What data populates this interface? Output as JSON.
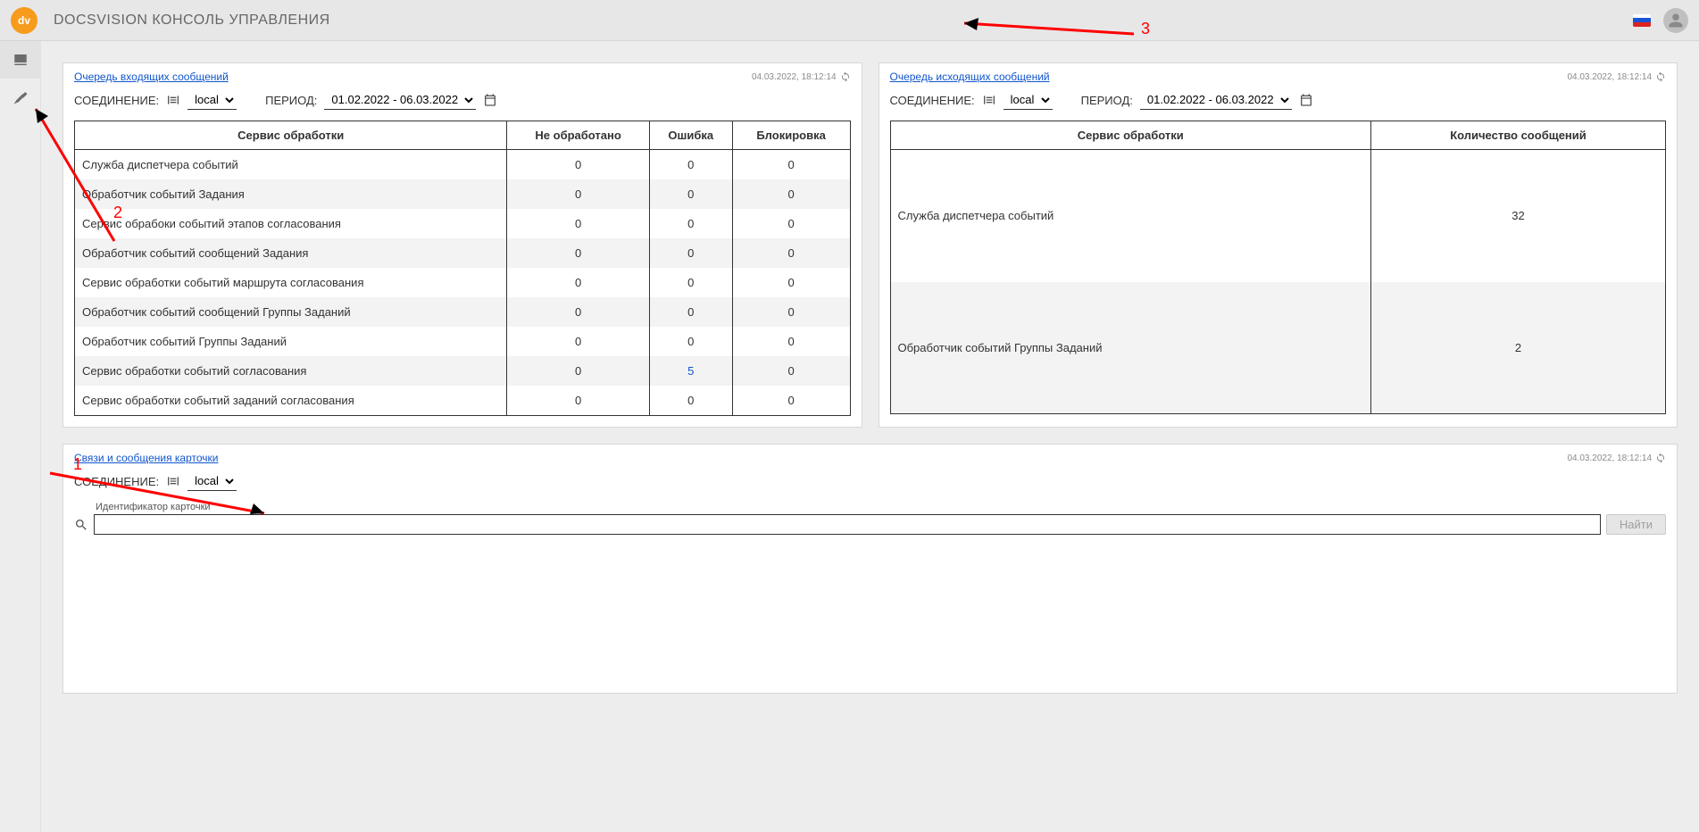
{
  "header": {
    "logo_text": "dv",
    "title": "DOCSVISION КОНСОЛЬ УПРАВЛЕНИЯ"
  },
  "annotations": {
    "n1": "1",
    "n2": "2",
    "n3": "3"
  },
  "incoming": {
    "link": "Очередь входящих сообщений",
    "timestamp": "04.03.2022, 18:12:14",
    "connection_label": "СОЕДИНЕНИЕ:",
    "connection_value": "local",
    "period_label": "ПЕРИОД:",
    "period_value": "01.02.2022 - 06.03.2022",
    "cols": {
      "service": "Сервис обработки",
      "unprocessed": "Не обработано",
      "error": "Ошибка",
      "blocked": "Блокировка"
    },
    "rows": [
      {
        "service": "Служба диспетчера событий",
        "unprocessed": "0",
        "error": "0",
        "blocked": "0"
      },
      {
        "service": "Обработчик событий Задания",
        "unprocessed": "0",
        "error": "0",
        "blocked": "0"
      },
      {
        "service": "Сервис обрабоки событий этапов согласования",
        "unprocessed": "0",
        "error": "0",
        "blocked": "0"
      },
      {
        "service": "Обработчик событий сообщений Задания",
        "unprocessed": "0",
        "error": "0",
        "blocked": "0"
      },
      {
        "service": "Сервис обработки событий маршрута согласования",
        "unprocessed": "0",
        "error": "0",
        "blocked": "0"
      },
      {
        "service": "Обработчик событий сообщений Группы Заданий",
        "unprocessed": "0",
        "error": "0",
        "blocked": "0"
      },
      {
        "service": "Обработчик событий Группы Заданий",
        "unprocessed": "0",
        "error": "0",
        "blocked": "0"
      },
      {
        "service": "Сервис обработки событий согласования",
        "unprocessed": "0",
        "error": "5",
        "blocked": "0",
        "error_link": true
      },
      {
        "service": "Сервис обработки событий заданий согласования",
        "unprocessed": "0",
        "error": "0",
        "blocked": "0"
      }
    ]
  },
  "outgoing": {
    "link": "Очередь исходящих сообщений",
    "timestamp": "04.03.2022, 18:12:14",
    "connection_label": "СОЕДИНЕНИЕ:",
    "connection_value": "local",
    "period_label": "ПЕРИОД:",
    "period_value": "01.02.2022 - 06.03.2022",
    "cols": {
      "service": "Сервис обработки",
      "count": "Количество сообщений"
    },
    "rows": [
      {
        "service": "Служба диспетчера событий",
        "count": "32"
      },
      {
        "service": "Обработчик событий Группы Заданий",
        "count": "2"
      }
    ]
  },
  "links_card": {
    "link": "Связи и сообщения карточки",
    "timestamp": "04.03.2022, 18:12:14",
    "connection_label": "СОЕДИНЕНИЕ:",
    "connection_value": "local",
    "search_label": "Идентификатор карточки",
    "find_btn": "Найти"
  }
}
